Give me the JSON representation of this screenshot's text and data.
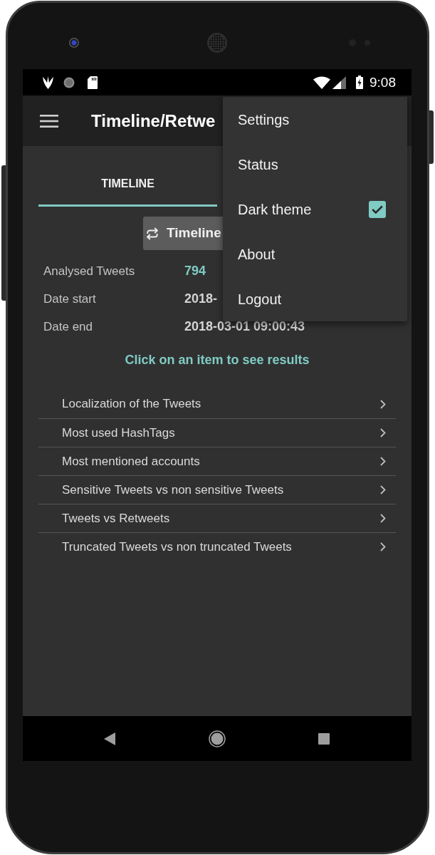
{
  "status_bar": {
    "time": "9:08"
  },
  "app_bar": {
    "title": "Timeline/Retwe"
  },
  "tabs": [
    {
      "label": "TIMELINE",
      "selected": true
    }
  ],
  "action_button": {
    "label": "Timeline"
  },
  "stats": [
    {
      "label": "Analysed Tweets",
      "value": "794",
      "kind": "count"
    },
    {
      "label": "Date start",
      "value": "2018-",
      "kind": "date"
    },
    {
      "label": "Date end",
      "value": "2018-03-01 09:00:43",
      "kind": "date"
    }
  ],
  "hint": "Click on an item to see results",
  "results": [
    {
      "label": "Localization of the Tweets"
    },
    {
      "label": "Most used HashTags"
    },
    {
      "label": "Most mentioned accounts"
    },
    {
      "label": "Sensitive Tweets vs non sensitive Tweets"
    },
    {
      "label": "Tweets vs Retweets"
    },
    {
      "label": "Truncated Tweets vs non truncated Tweets"
    }
  ],
  "menu": {
    "items": [
      {
        "label": "Settings",
        "kind": "plain"
      },
      {
        "label": "Status",
        "kind": "plain"
      },
      {
        "label": "Dark theme",
        "kind": "checkbox",
        "checked": true
      },
      {
        "label": "About",
        "kind": "plain"
      },
      {
        "label": "Logout",
        "kind": "plain"
      }
    ]
  }
}
